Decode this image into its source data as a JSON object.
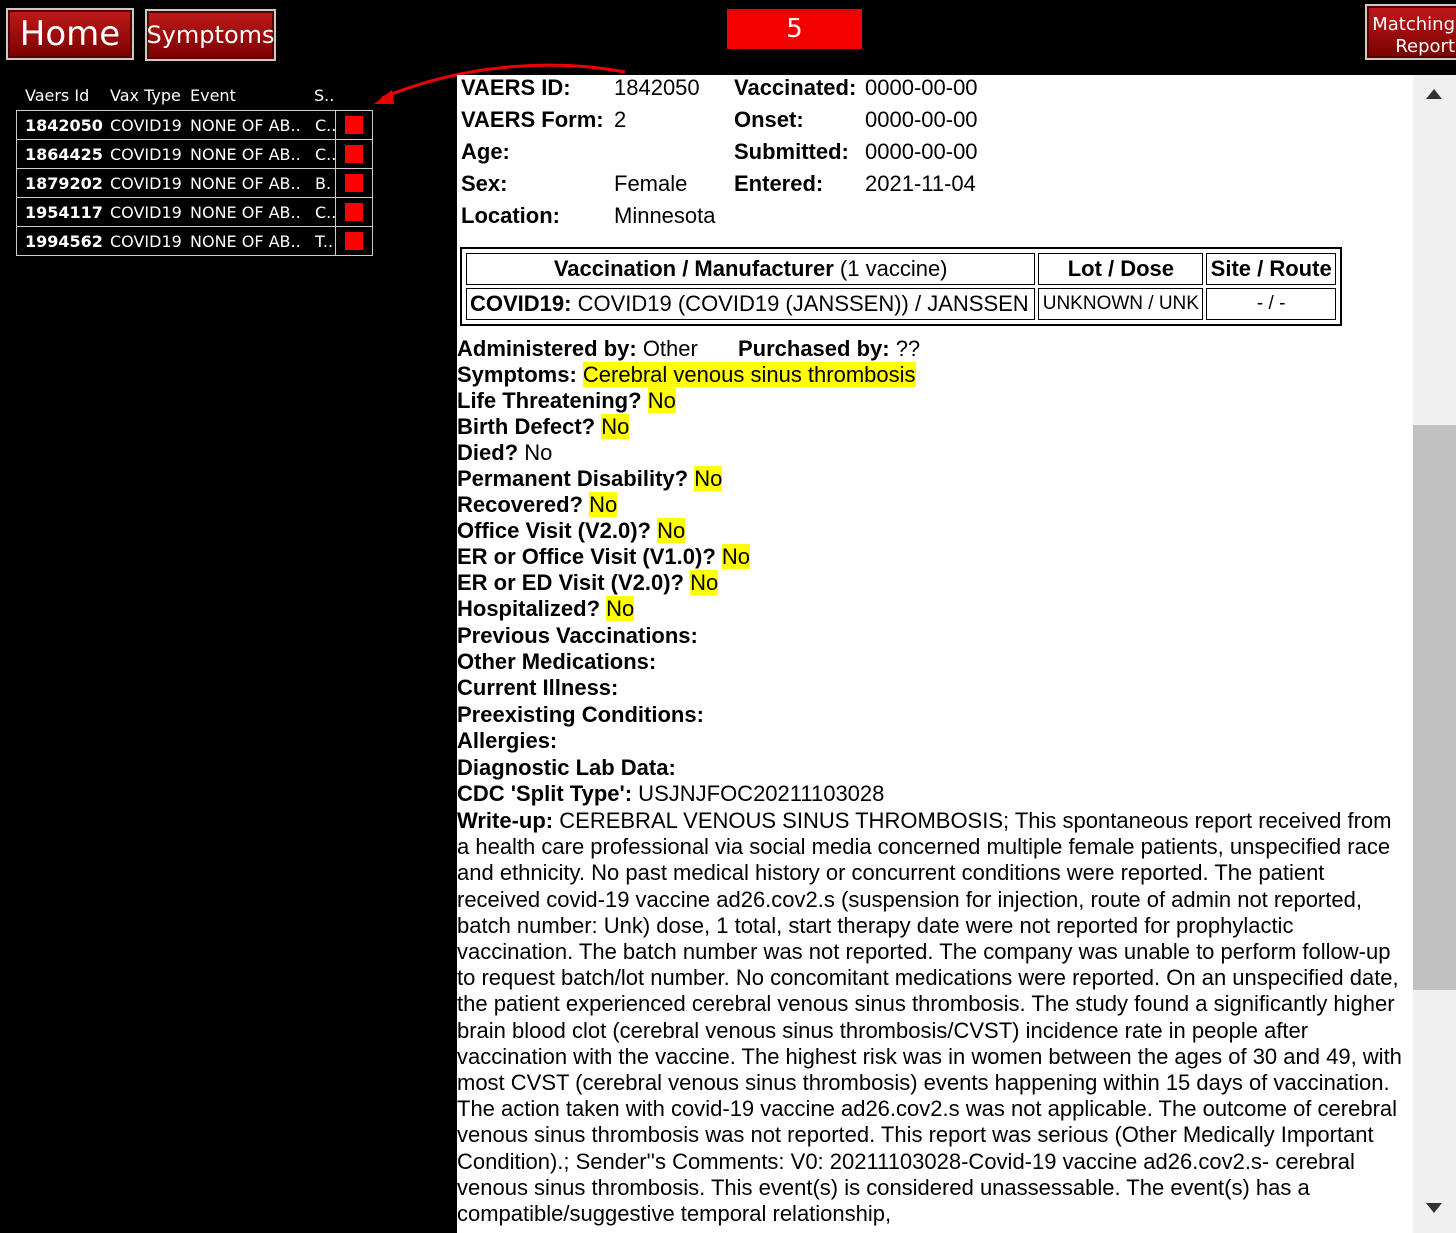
{
  "nav": {
    "home_label": "Home",
    "symptoms_label": "Symptoms",
    "matching_line1": "Matching",
    "matching_line2": "Report",
    "count": "5"
  },
  "list": {
    "headers": [
      "Vaers Id",
      "Vax Type",
      "Event",
      "S.."
    ],
    "rows": [
      {
        "id": "1842050",
        "vax": "COVID19",
        "event": "NONE OF AB..",
        "s": "C.."
      },
      {
        "id": "1864425",
        "vax": "COVID19",
        "event": "NONE OF AB..",
        "s": "C.."
      },
      {
        "id": "1879202",
        "vax": "COVID19",
        "event": "NONE OF AB..",
        "s": "B."
      },
      {
        "id": "1954117",
        "vax": "COVID19",
        "event": "NONE OF AB..",
        "s": "C.."
      },
      {
        "id": "1994562",
        "vax": "COVID19",
        "event": "NONE OF AB..",
        "s": "T.."
      }
    ]
  },
  "report": {
    "vaers_id_label": "VAERS ID:",
    "vaers_id": "1842050",
    "form_label": "VAERS Form:",
    "form": "2",
    "age_label": "Age:",
    "sex_label": "Sex:",
    "sex": "Female",
    "location_label": "Location:",
    "location": "Minnesota",
    "vaccinated_label": "Vaccinated:",
    "vaccinated": "0000-00-00",
    "onset_label": "Onset:",
    "onset": "0000-00-00",
    "submitted_label": "Submitted:",
    "submitted": "0000-00-00",
    "entered_label": "Entered:",
    "entered": "2021-11-04"
  },
  "vaccine_table": {
    "h1_bold": "Vaccination / Manufacturer",
    "h1_rest": " (1 vaccine)",
    "h2": "Lot / Dose",
    "h3": "Site / Route",
    "type": "COVID19:",
    "name": " COVID19 (COVID19 (JANSSEN)) / JANSSEN",
    "lot": "UNKNOWN / UNK",
    "site": "- / -"
  },
  "details": {
    "administered_label": "Administered by:",
    "administered": " Other",
    "purchased_label": "Purchased by:",
    "purchased": " ??",
    "symptoms_label": "Symptoms:",
    "symptoms": "Cerebral venous sinus thrombosis",
    "life_label": "Life Threatening?",
    "life": "No",
    "birth_label": "Birth Defect?",
    "birth": "No",
    "died_label": "Died?",
    "died": "No",
    "disability_label": "Permanent Disability?",
    "disability": "No",
    "recovered_label": "Recovered?",
    "recovered": "No",
    "office_label": "Office Visit (V2.0)?",
    "office": "No",
    "er_office_label": "ER or Office Visit (V1.0)?",
    "er_office": "No",
    "er_ed_label": "ER or ED Visit (V2.0)?",
    "er_ed": "No",
    "hosp_label": "Hospitalized?",
    "hosp": "No",
    "prev_vax_label": "Previous Vaccinations:",
    "other_meds_label": "Other Medications:",
    "current_illness_label": "Current Illness:",
    "preexisting_label": "Preexisting Conditions:",
    "allergies_label": "Allergies:",
    "lab_label": "Diagnostic Lab Data:",
    "split_label": "CDC 'Split Type':",
    "split": " USJNJFOC20211103028",
    "writeup_label": "Write-up:",
    "writeup": " CEREBRAL VENOUS SINUS THROMBOSIS; This spontaneous report received from a health care professional via social media concerned multiple female patients, unspecified race and ethnicity. No past medical history or concurrent conditions were reported. The patient received covid-19 vaccine ad26.cov2.s (suspension for injection, route of admin not reported, batch number: Unk) dose, 1 total, start therapy date were not reported for prophylactic vaccination. The batch number was not reported. The company was unable to perform follow-up to request batch/lot number. No concomitant medications were reported. On an unspecified date, the patient experienced cerebral venous sinus thrombosis. The study found a significantly higher brain blood clot (cerebral venous sinus thrombosis/CVST) incidence rate in people after vaccination with the vaccine. The highest risk was in women between the ages of 30 and 49, with most CVST (cerebral venous sinus thrombosis) events happening within 15 days of vaccination. The action taken with covid-19 vaccine ad26.cov2.s was not applicable. The outcome of cerebral venous sinus thrombosis was not reported. This report was serious (Other Medically Important Condition).; Sender''s Comments: V0: 20211103028-Covid-19 vaccine ad26.cov2.s- cerebral venous sinus thrombosis. This event(s) is considered unassessable. The event(s) has a compatible/suggestive temporal relationship,"
  },
  "colors": {
    "accent_red": "#f20000",
    "highlight": "#ffff00"
  }
}
